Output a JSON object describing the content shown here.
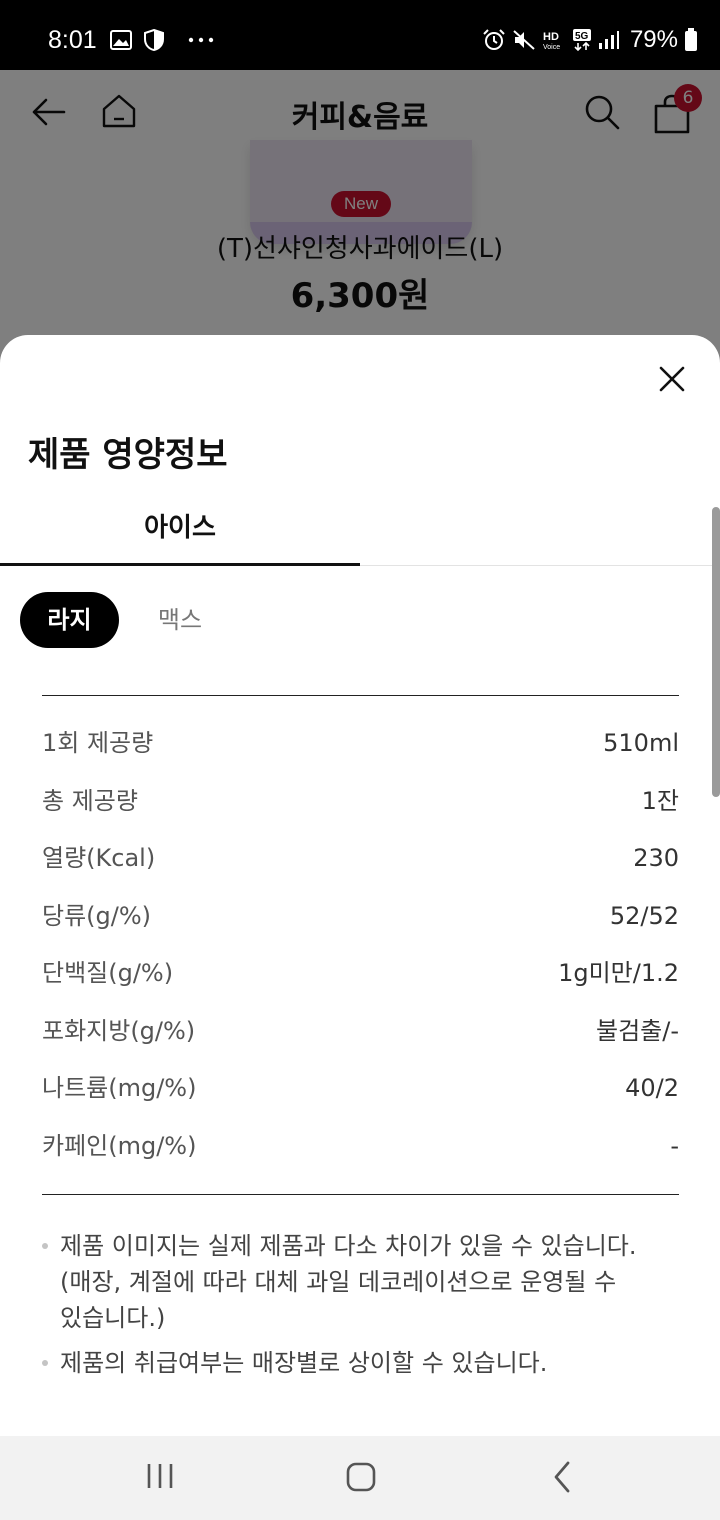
{
  "status_bar": {
    "time": "8:01",
    "battery": "79%",
    "icons": [
      "gallery-icon",
      "shield-icon",
      "more-dots-icon",
      "alarm-icon",
      "mute-icon",
      "hd-voice-icon",
      "5g-icon",
      "signal-icon",
      "battery-icon"
    ]
  },
  "header": {
    "title": "커피&음료",
    "cart_count": "6"
  },
  "product": {
    "badge": "New",
    "name": "(T)선샤인청사과에이드(L)",
    "price": "6,300원"
  },
  "sheet": {
    "title": "제품 영양정보",
    "tabs": [
      {
        "label": "아이스",
        "active": true
      }
    ],
    "sizes": [
      {
        "label": "라지",
        "active": true
      },
      {
        "label": "맥스",
        "active": false
      }
    ],
    "nutrition": [
      {
        "label": "1회 제공량",
        "value": "510ml"
      },
      {
        "label": "총 제공량",
        "value": "1잔"
      },
      {
        "label": "열량(Kcal)",
        "value": "230"
      },
      {
        "label": "당류(g/%)",
        "value": "52/52"
      },
      {
        "label": "단백질(g/%)",
        "value": "1g미만/1.2"
      },
      {
        "label": "포화지방(g/%)",
        "value": "불검출/-"
      },
      {
        "label": "나트륨(mg/%)",
        "value": "40/2"
      },
      {
        "label": "카페인(mg/%)",
        "value": "-"
      }
    ],
    "notes": [
      {
        "line1": "제품 이미지는 실제 제품과 다소 차이가 있을 수 있습니다.",
        "line2": "(매장, 계절에 따라 대체 과일 데코레이션으로 운영될 수",
        "line3": "있습니다.)"
      },
      {
        "line1": "제품의 취급여부는 매장별로 상이할 수 있습니다."
      }
    ]
  },
  "colors": {
    "brand_red": "#c8102e",
    "chip_active_bg": "#000000",
    "overlay": "rgba(0,0,0,0.5)"
  }
}
